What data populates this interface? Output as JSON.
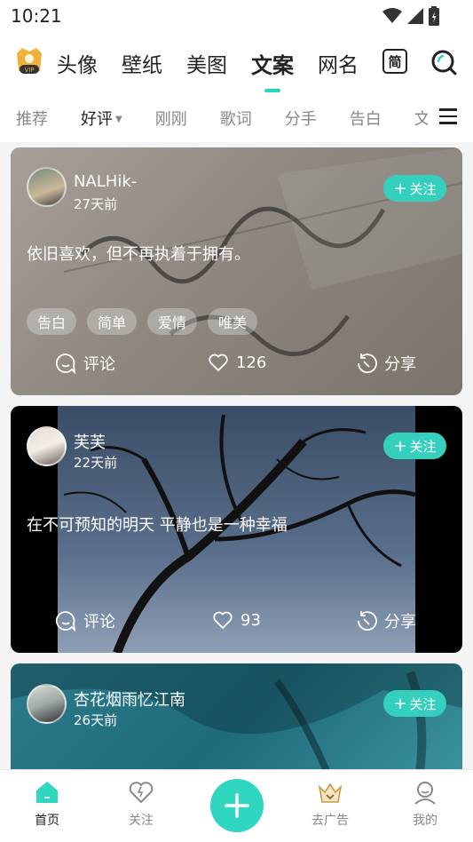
{
  "status": {
    "time": "10:21"
  },
  "top_nav": {
    "tabs": [
      "头像",
      "壁纸",
      "美图",
      "文案",
      "网名"
    ],
    "active_tab": "文案",
    "simplified_label": "简",
    "vip_label": "VIP"
  },
  "sub_nav": {
    "items": [
      "推荐",
      "好评",
      "刚刚",
      "歌词",
      "分手",
      "告白",
      "文"
    ],
    "active": "好评"
  },
  "posts": [
    {
      "user": "NALHik-",
      "time": "27天前",
      "follow_label": "关注",
      "text": "依旧喜欢，但不再执着于拥有。",
      "tags": [
        "告白",
        "简单",
        "爱情",
        "唯美"
      ],
      "comment_label": "评论",
      "likes": "126",
      "share_label": "分享"
    },
    {
      "user": "芙芙",
      "time": "22天前",
      "follow_label": "关注",
      "text": "在不可预知的明天 平静也是一种幸福",
      "comment_label": "评论",
      "likes": "93",
      "share_label": "分享"
    },
    {
      "user": "杏花烟雨忆江南",
      "time": "26天前",
      "follow_label": "关注"
    }
  ],
  "bottom_nav": {
    "items": [
      "首页",
      "关注",
      "去广告",
      "我的"
    ],
    "active": "首页"
  },
  "colors": {
    "accent": "#2fd6c0",
    "follow_bg": "#35d0bd"
  }
}
